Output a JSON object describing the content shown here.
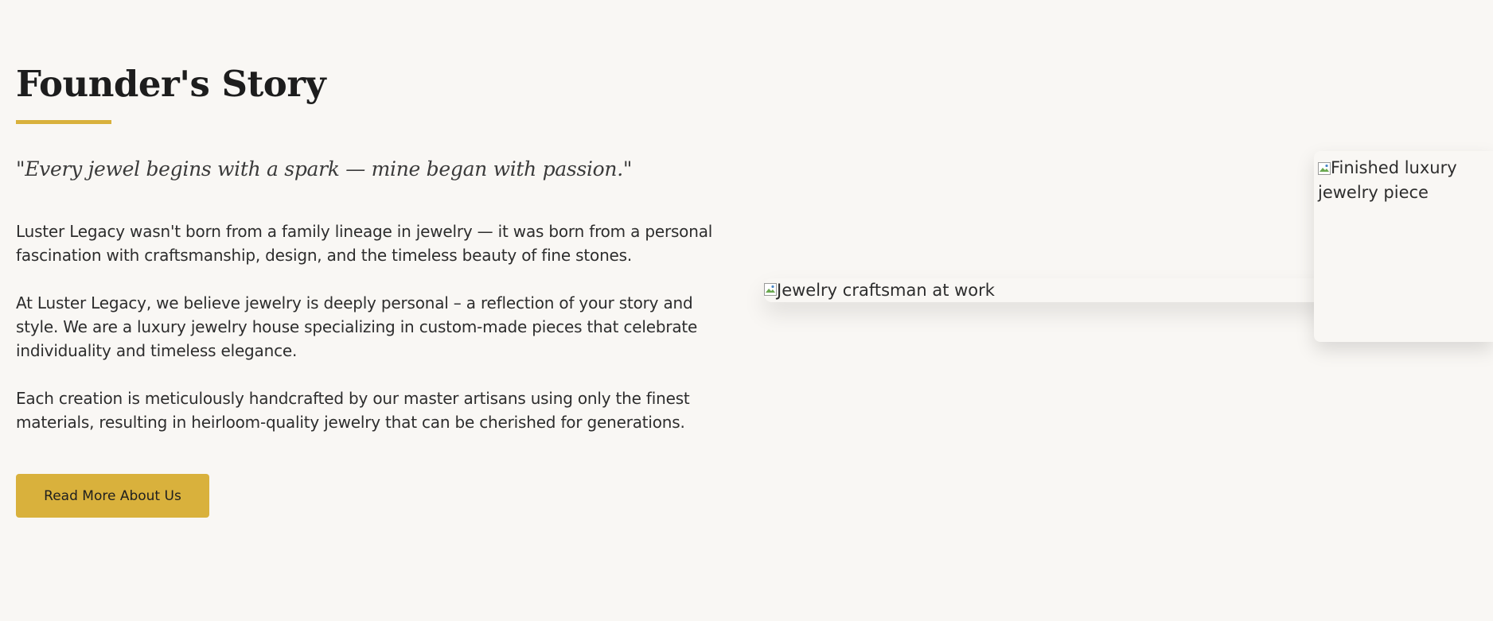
{
  "founder": {
    "heading": "Founder's Story",
    "quote": "\"Every jewel begins with a spark — mine began with passion.\"",
    "paragraphs": [
      "Luster Legacy wasn't born from a family lineage in jewelry — it was born from a personal fascination with craftsmanship, design, and the timeless beauty of fine stones.",
      "At Luster Legacy, we believe jewelry is deeply personal – a reflection of your story and style. We are a luxury jewelry house specializing in custom-made pieces that celebrate individuality and timeless elegance.",
      "Each creation is meticulously handcrafted by our master artisans using only the finest materials, resulting in heirloom-quality jewelry that can be cherished for generations."
    ],
    "button_label": "Read More About Us"
  },
  "images": {
    "main_alt": "Jewelry craftsman at work",
    "secondary_alt": "Finished luxury jewelry piece"
  },
  "colors": {
    "background": "#f9f7f4",
    "accent_gold": "#d9b13c",
    "heading_text": "#1d1d1d",
    "body_text": "#2d2d2d"
  }
}
